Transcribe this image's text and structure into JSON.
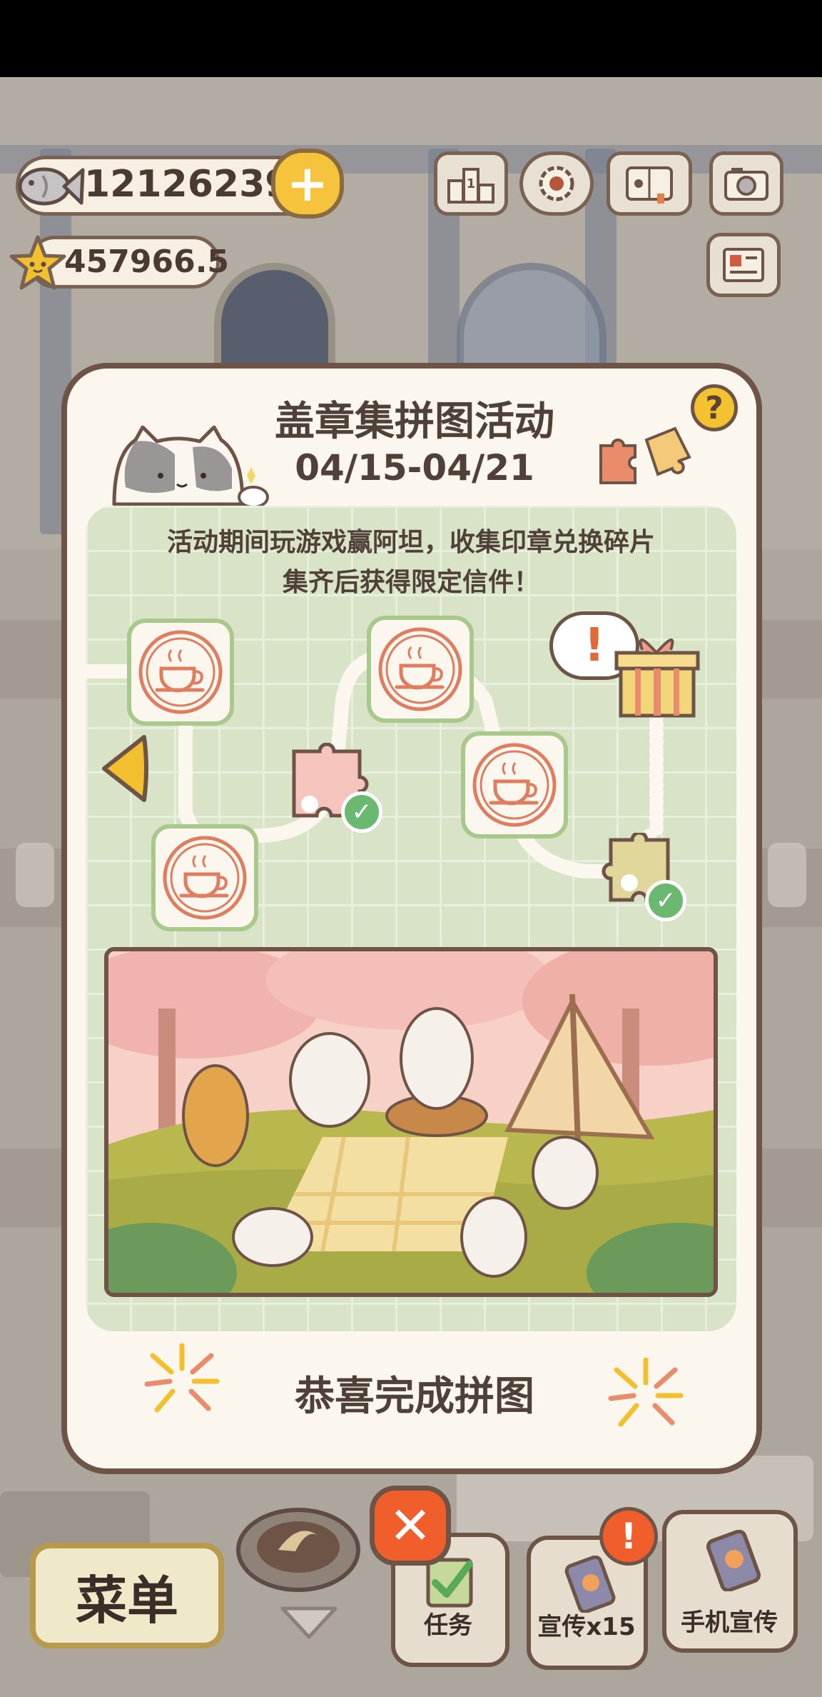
{
  "currency": {
    "fish_amount": "12126239",
    "star_amount": "457966.5"
  },
  "top_icons": [
    "ranking-icon",
    "settings-gear-icon",
    "cat-album-icon",
    "camera-icon",
    "mail-icon"
  ],
  "event": {
    "title": "盖章集拼图活动",
    "dates": "04/15-04/21",
    "help_label": "?",
    "description_line1": "活动期间玩游戏赢阿坦，收集印章兑换碎片",
    "description_line2": "集齐后获得限定信件！",
    "gift_alert": "!",
    "congrats": "恭喜完成拼图",
    "close_label": "✕"
  },
  "bottom_bar": {
    "menu_label": "菜单",
    "tasks_label": "任务",
    "promo_label": "宣传x15",
    "alert_badge": "!",
    "phone_promo_label": "手机宣传"
  },
  "colors": {
    "modal_bg": "#fcf7ee",
    "border_brown": "#6d5447",
    "board_green": "#d8e3c7",
    "stamp_border": "#a9c98c",
    "close_orange": "#ef5e2b",
    "accent_yellow": "#f5c43c"
  }
}
